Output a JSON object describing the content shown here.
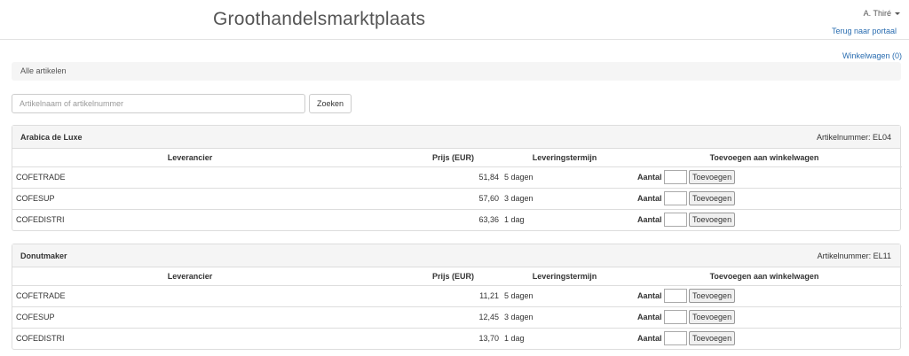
{
  "header": {
    "title": "Groothandelsmarktplaats",
    "user": "A. Thiré",
    "portal_link": "Terug naar portaal",
    "cart_link": "Winkelwagen (0)"
  },
  "breadcrumb": "Alle artikelen",
  "search": {
    "placeholder": "Artikelnaam of artikelnummer",
    "button": "Zoeken"
  },
  "columns": {
    "supplier": "Leverancier",
    "price": "Prijs (EUR)",
    "term": "Leveringstermijn",
    "add": "Toevoegen aan winkelwagen"
  },
  "qty_label": "Aantal",
  "add_button": "Toevoegen",
  "article_label": "Artikelnummer:",
  "products": [
    {
      "name": "Arabica de Luxe",
      "article_no": "EL04",
      "rows": [
        {
          "supplier": "COFETRADE",
          "price": "51,84",
          "term": "5 dagen"
        },
        {
          "supplier": "COFESUP",
          "price": "57,60",
          "term": "3 dagen"
        },
        {
          "supplier": "COFEDISTRI",
          "price": "63,36",
          "term": "1 dag"
        }
      ]
    },
    {
      "name": "Donutmaker",
      "article_no": "EL11",
      "rows": [
        {
          "supplier": "COFETRADE",
          "price": "11,21",
          "term": "5 dagen"
        },
        {
          "supplier": "COFESUP",
          "price": "12,45",
          "term": "3 dagen"
        },
        {
          "supplier": "COFEDISTRI",
          "price": "13,70",
          "term": "1 dag"
        }
      ]
    }
  ]
}
